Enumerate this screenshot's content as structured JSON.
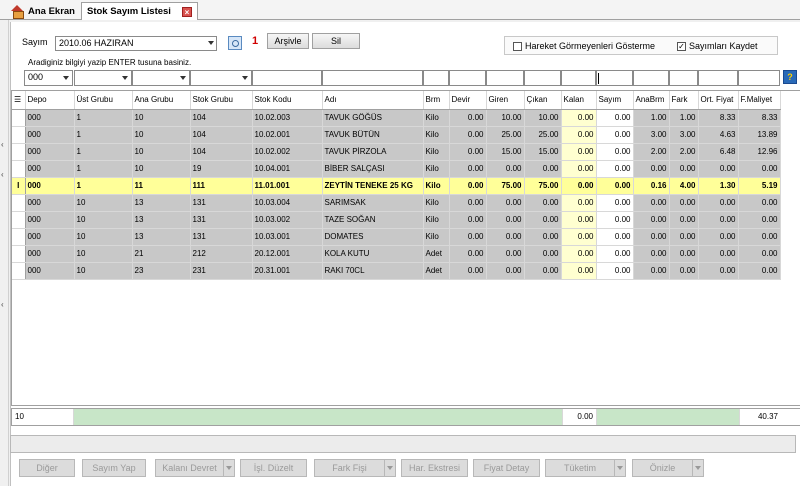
{
  "tabs": [
    {
      "label": "Ana Ekran"
    },
    {
      "label": "Stok Sayım Listesi"
    }
  ],
  "toolbar": {
    "sayim_label": "Sayım",
    "sayim_value": "2010.06 HAZIRAN",
    "badge": "1",
    "arsiv_label": "Arşivle",
    "sil_label": "Sil"
  },
  "options": {
    "hide_unmoved": {
      "label": "Hareket Görmeyenleri Gösterme",
      "checked": false
    },
    "save_counts": {
      "label": "Sayımları Kaydet",
      "checked": true
    }
  },
  "hint": "Aradiginiz bilgiyi yazip ENTER tusuna basiniz.",
  "filter": {
    "depo": "000"
  },
  "columns": [
    "Depo",
    "Üst Grubu",
    "Ana Grubu",
    "Stok Grubu",
    "Stok Kodu",
    "Adı",
    "Brm",
    "Devir",
    "Giren",
    "Çıkan",
    "Kalan",
    "Sayım",
    "AnaBrm",
    "Fark",
    "Ort. Fiyat",
    "F.Maliyet"
  ],
  "rows": [
    [
      "000",
      "1",
      "10",
      "104",
      "10.02.003",
      "TAVUK GÖĞÜS",
      "Kilo",
      "0.00",
      "10.00",
      "10.00",
      "0.00",
      "0.00",
      "1.00",
      "1.00",
      "8.33",
      "8.33"
    ],
    [
      "000",
      "1",
      "10",
      "104",
      "10.02.001",
      "TAVUK BÜTÜN",
      "Kilo",
      "0.00",
      "25.00",
      "25.00",
      "0.00",
      "0.00",
      "3.00",
      "3.00",
      "4.63",
      "13.89"
    ],
    [
      "000",
      "1",
      "10",
      "104",
      "10.02.002",
      "TAVUK PİRZOLA",
      "Kilo",
      "0.00",
      "15.00",
      "15.00",
      "0.00",
      "0.00",
      "2.00",
      "2.00",
      "6.48",
      "12.96"
    ],
    [
      "000",
      "1",
      "10",
      "19",
      "10.04.001",
      "BİBER SALÇASI",
      "Kilo",
      "0.00",
      "0.00",
      "0.00",
      "0.00",
      "0.00",
      "0.00",
      "0.00",
      "0.00",
      "0.00"
    ],
    [
      "000",
      "1",
      "11",
      "111",
      "11.01.001",
      "ZEYTİN TENEKE 25 KG",
      "Kilo",
      "0.00",
      "75.00",
      "75.00",
      "0.00",
      "0.00",
      "0.16",
      "4.00",
      "1.30",
      "5.19"
    ],
    [
      "000",
      "10",
      "13",
      "131",
      "10.03.004",
      "SARIMSAK",
      "Kilo",
      "0.00",
      "0.00",
      "0.00",
      "0.00",
      "0.00",
      "0.00",
      "0.00",
      "0.00",
      "0.00"
    ],
    [
      "000",
      "10",
      "13",
      "131",
      "10.03.002",
      "TAZE SOĞAN",
      "Kilo",
      "0.00",
      "0.00",
      "0.00",
      "0.00",
      "0.00",
      "0.00",
      "0.00",
      "0.00",
      "0.00"
    ],
    [
      "000",
      "10",
      "13",
      "131",
      "10.03.001",
      "DOMATES",
      "Kilo",
      "0.00",
      "0.00",
      "0.00",
      "0.00",
      "0.00",
      "0.00",
      "0.00",
      "0.00",
      "0.00"
    ],
    [
      "000",
      "10",
      "21",
      "212",
      "20.12.001",
      "KOLA KUTU",
      "Adet",
      "0.00",
      "0.00",
      "0.00",
      "0.00",
      "0.00",
      "0.00",
      "0.00",
      "0.00",
      "0.00"
    ],
    [
      "000",
      "10",
      "23",
      "231",
      "20.31.001",
      "RAKI 70CL",
      "Adet",
      "0.00",
      "0.00",
      "0.00",
      "0.00",
      "0.00",
      "0.00",
      "0.00",
      "0.00",
      "0.00"
    ]
  ],
  "selected_row": 4,
  "footer": {
    "count": "10",
    "kalan_total": "0.00",
    "maliyet_total": "40.37"
  },
  "buttons": [
    "Diğer",
    "Sayım Yap",
    "Kalanı Devret",
    "İşl. Düzelt",
    "Fark Fişi",
    "Har. Ekstresi",
    "Fiyat Detay",
    "Tüketim",
    "Önizle"
  ],
  "colors": {
    "selected_row": "#ffff99",
    "grid_gray": "#c8c8c8",
    "yellow_col": "#ffffd0",
    "badge": "#d00000"
  }
}
